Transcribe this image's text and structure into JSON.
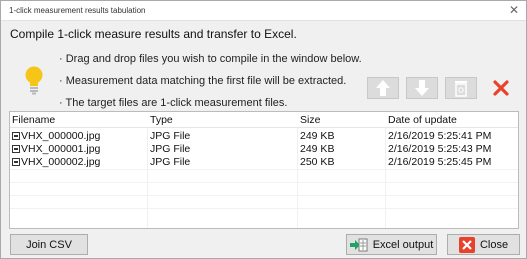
{
  "window": {
    "title": "1-click measurement results tabulation",
    "close_glyph": "✕"
  },
  "headline": "Compile 1-click measure results and transfer to Excel.",
  "instructions": [
    "· Drag and drop files you wish to compile in the window below.",
    "· Measurement data matching the first file will be extracted.",
    "· The target files are 1-click measurement files."
  ],
  "toolbar": {
    "icons": [
      "arrow-up-icon",
      "arrow-down-icon",
      "trash-icon",
      "delete-x-icon"
    ],
    "delete_color": "#e8412c"
  },
  "table": {
    "headers": [
      "Filename",
      "Type",
      "Size",
      "Date of update"
    ],
    "rows": [
      [
        "VHX_000000.jpg",
        "JPG File",
        "249 KB",
        "2/16/2019 5:25:41 PM"
      ],
      [
        "VHX_000001.jpg",
        "JPG File",
        "249 KB",
        "2/16/2019 5:25:43 PM"
      ],
      [
        "VHX_000002.jpg",
        "JPG File",
        "250 KB",
        "2/16/2019 5:25:45 PM"
      ]
    ]
  },
  "buttons": {
    "join_csv": "Join CSV",
    "excel_output": "Excel output",
    "close": "Close"
  },
  "colors": {
    "bulb": "#f5c518",
    "excel_green": "#21a366",
    "close_red": "#e8412c"
  }
}
